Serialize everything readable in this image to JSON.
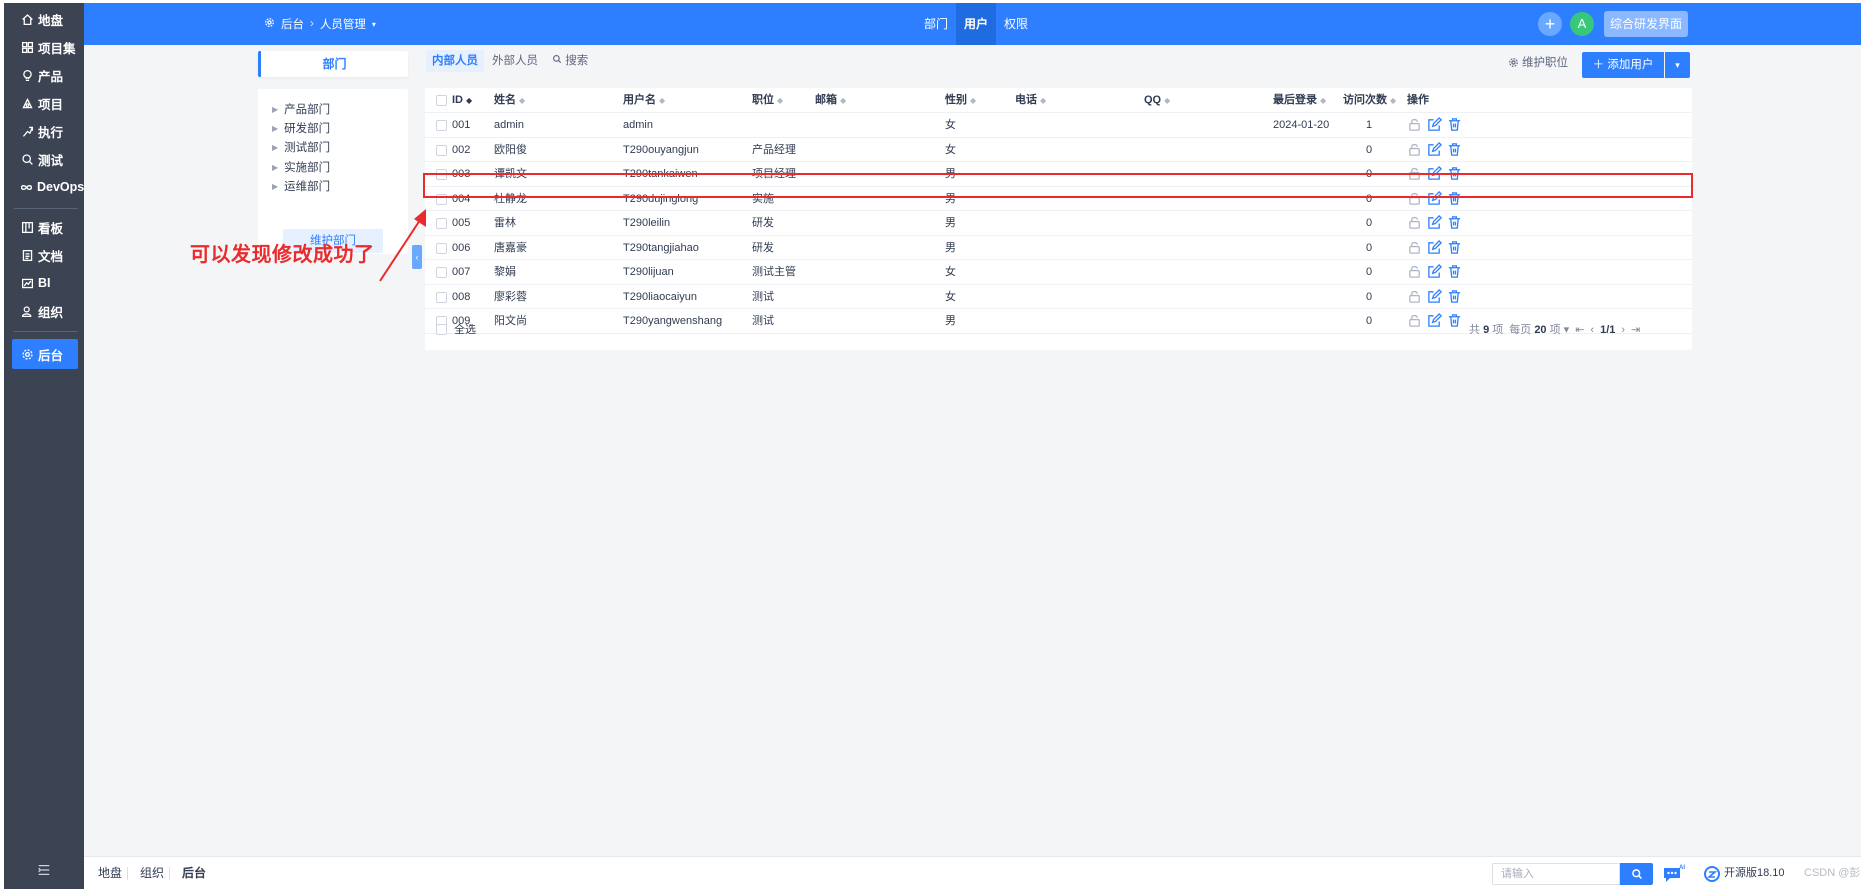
{
  "sidebar": {
    "items": [
      {
        "label": "地盘",
        "icon": "home-icon"
      },
      {
        "label": "项目集",
        "icon": "grid-icon"
      },
      {
        "label": "产品",
        "icon": "bulb-icon"
      },
      {
        "label": "项目",
        "icon": "project-icon"
      },
      {
        "label": "执行",
        "icon": "run-icon"
      },
      {
        "label": "测试",
        "icon": "search-icon"
      },
      {
        "label": "DevOps",
        "icon": "infinity-icon"
      },
      {
        "label": "看板",
        "icon": "kanban-icon"
      },
      {
        "label": "文档",
        "icon": "doc-icon"
      },
      {
        "label": "BI",
        "icon": "chart-icon"
      },
      {
        "label": "组织",
        "icon": "team-icon"
      },
      {
        "label": "后台",
        "icon": "gear-icon"
      }
    ],
    "active": "后台"
  },
  "header": {
    "breadcrumb": {
      "root": "后台",
      "current": "人员管理"
    },
    "tabs": [
      "部门",
      "用户",
      "权限"
    ],
    "active_tab": "用户",
    "avatar_letter": "A",
    "switch_label": "综合研发界面",
    "accent": "#2e7fff"
  },
  "dept": {
    "tab_label": "部门",
    "items": [
      "产品部门",
      "研发部门",
      "测试部门",
      "实施部门",
      "运维部门"
    ],
    "maintain_label": "维护部门"
  },
  "toolbar": {
    "tabs": [
      "内部人员",
      "外部人员",
      "搜索"
    ],
    "active_tab": "内部人员",
    "maintain_position": "维护职位",
    "add_user": "添加用户"
  },
  "table": {
    "columns": [
      "ID",
      "姓名",
      "用户名",
      "职位",
      "邮箱",
      "性别",
      "电话",
      "QQ",
      "最后登录",
      "访问次数",
      "操作"
    ],
    "rows": [
      {
        "id": "001",
        "name": "admin",
        "username": "admin",
        "position": "",
        "email": "",
        "gender": "女",
        "phone": "",
        "qq": "",
        "last_login": "2024-01-20",
        "visits": "1"
      },
      {
        "id": "002",
        "name": "欧阳俊",
        "username": "T290ouyangjun",
        "position": "产品经理",
        "email": "",
        "gender": "女",
        "phone": "",
        "qq": "",
        "last_login": "",
        "visits": "0"
      },
      {
        "id": "003",
        "name": "谭凯文",
        "username": "T290tankaiwen",
        "position": "项目经理",
        "email": "",
        "gender": "男",
        "phone": "",
        "qq": "",
        "last_login": "",
        "visits": "0"
      },
      {
        "id": "004",
        "name": "杜静龙",
        "username": "T290dujinglong",
        "position": "实施",
        "email": "",
        "gender": "男",
        "phone": "",
        "qq": "",
        "last_login": "",
        "visits": "0"
      },
      {
        "id": "005",
        "name": "雷林",
        "username": "T290leilin",
        "position": "研发",
        "email": "",
        "gender": "男",
        "phone": "",
        "qq": "",
        "last_login": "",
        "visits": "0"
      },
      {
        "id": "006",
        "name": "唐嘉豪",
        "username": "T290tangjiahao",
        "position": "研发",
        "email": "",
        "gender": "男",
        "phone": "",
        "qq": "",
        "last_login": "",
        "visits": "0"
      },
      {
        "id": "007",
        "name": "黎娟",
        "username": "T290lijuan",
        "position": "测试主管",
        "email": "",
        "gender": "女",
        "phone": "",
        "qq": "",
        "last_login": "",
        "visits": "0"
      },
      {
        "id": "008",
        "name": "廖彩蓉",
        "username": "T290liaocaiyun",
        "position": "测试",
        "email": "",
        "gender": "女",
        "phone": "",
        "qq": "",
        "last_login": "",
        "visits": "0"
      },
      {
        "id": "009",
        "name": "阳文尚",
        "username": "T290yangwenshang",
        "position": "测试",
        "email": "",
        "gender": "男",
        "phone": "",
        "qq": "",
        "last_login": "",
        "visits": "0"
      }
    ],
    "highlighted_row": "004",
    "select_all": "全选",
    "pager": {
      "total": "共",
      "total_count": "9",
      "total_unit": "项",
      "per_page": "每页",
      "per_page_count": "20",
      "per_page_unit": "项",
      "page": "1/1"
    }
  },
  "annotation": {
    "text": "可以发现修改成功了",
    "color": "#ea2b2b"
  },
  "bottombar": {
    "items": [
      "地盘",
      "组织",
      "后台"
    ],
    "active": "后台",
    "search_placeholder": "请输入",
    "version": "开源版18.10",
    "watermark": "CSDN @彭彦姿"
  }
}
